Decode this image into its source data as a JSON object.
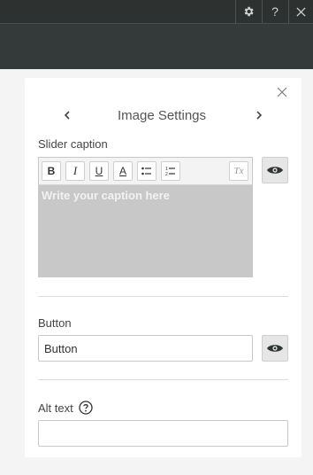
{
  "topbar": {
    "settings_icon": "gear-icon",
    "help_label": "?",
    "close_icon": "close-icon"
  },
  "panel": {
    "title": "Image Settings",
    "close_icon": "close-icon",
    "prev_icon": "chevron-left-icon",
    "next_icon": "chevron-right-icon",
    "caption": {
      "label": "Slider caption",
      "placeholder": "Write your caption here",
      "toolbar": {
        "bold": "B",
        "italic": "I",
        "underline": "U",
        "font_color": "A",
        "bullet_list_icon": "bulleted-list-icon",
        "numbered_list_icon": "numbered-list-icon",
        "clear_format": "Tx"
      },
      "visibility_icon": "eye-icon"
    },
    "button": {
      "label": "Button",
      "value": "Button",
      "visibility_icon": "eye-icon"
    },
    "alt_text": {
      "label": "Alt text",
      "value": "",
      "help_icon": "question-circle-icon"
    }
  },
  "colors": {
    "topbar": "#2d3231",
    "subbar": "#343a39",
    "editor_body": "#c8c8c8",
    "panel": "#ffffff"
  }
}
